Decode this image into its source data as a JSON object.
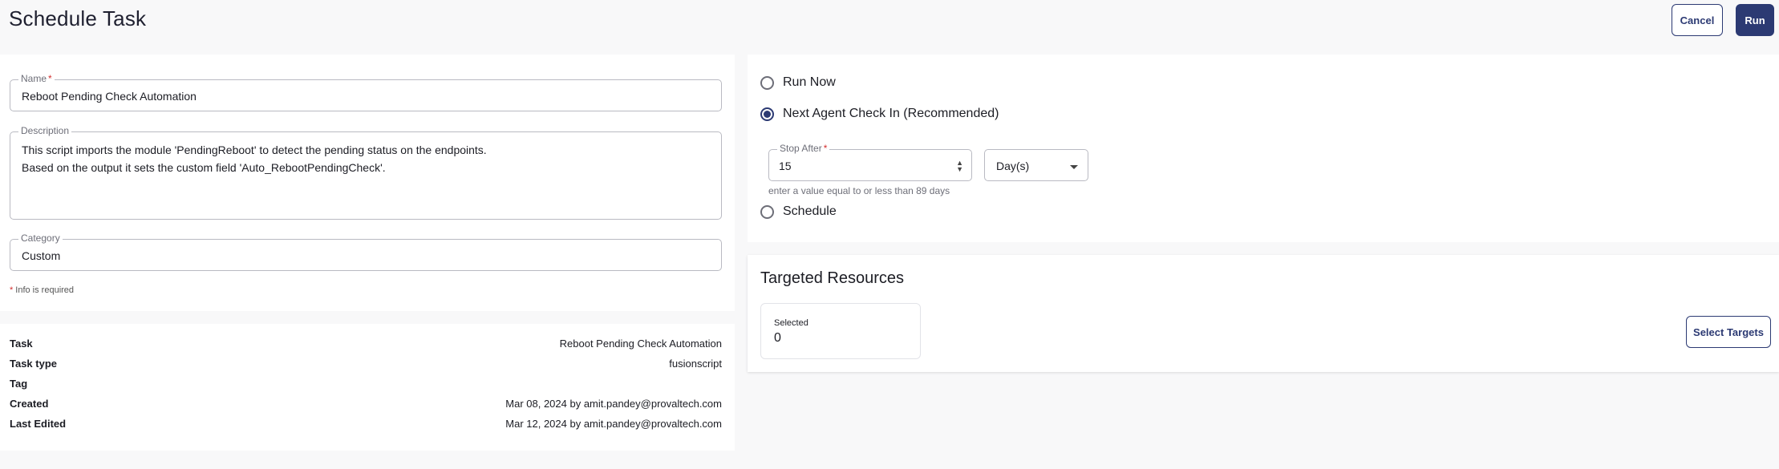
{
  "header": {
    "title": "Schedule Task",
    "cancel_label": "Cancel",
    "run_label": "Run"
  },
  "form": {
    "name": {
      "label": "Name",
      "required_mark": "*",
      "value": "Reboot Pending Check Automation"
    },
    "description": {
      "label": "Description",
      "lines": [
        "This script imports the module 'PendingReboot' to detect the pending status on the endpoints.",
        "Based on the output it sets the custom field 'Auto_RebootPendingCheck'."
      ]
    },
    "category": {
      "label": "Category",
      "value": "Custom"
    },
    "info_required": {
      "mark": "*",
      "text": "Info is required"
    }
  },
  "details": [
    {
      "key": "Task",
      "value": "Reboot Pending Check Automation"
    },
    {
      "key": "Task type",
      "value": "fusionscript"
    },
    {
      "key": "Tag",
      "value": ""
    },
    {
      "key": "Created",
      "value": "Mar 08, 2024 by amit.pandey@provaltech.com"
    },
    {
      "key": "Last Edited",
      "value": "Mar 12, 2024 by amit.pandey@provaltech.com"
    }
  ],
  "run_options": {
    "run_now": "Run Now",
    "next_check_in": "Next Agent Check In (Recommended)",
    "schedule": "Schedule",
    "selected_option": "next_check_in",
    "stop_after": {
      "label": "Stop After",
      "required_mark": "*",
      "value": "15",
      "unit": "Day(s)",
      "helper": "enter a value equal to or less than 89 days"
    }
  },
  "targets": {
    "title": "Targeted Resources",
    "selected_label": "Selected",
    "selected_count": "0",
    "select_button": "Select Targets"
  },
  "colors": {
    "accent": "#2c3a73",
    "required": "#d32f2f",
    "background": "#f8f8f9"
  },
  "icons": [
    "radio-unchecked-icon",
    "radio-checked-icon",
    "spinner-arrows-icon",
    "dropdown-caret-icon"
  ]
}
